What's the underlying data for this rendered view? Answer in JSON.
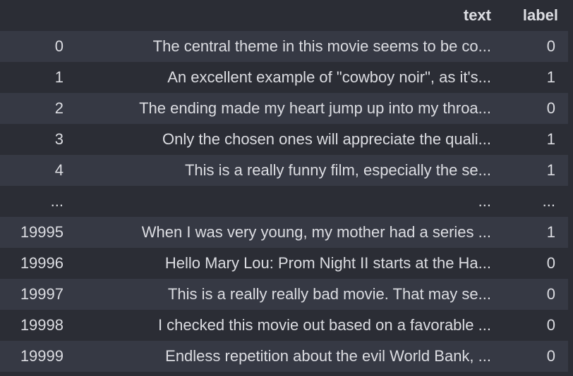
{
  "columns": {
    "index": "",
    "text": "text",
    "label": "label"
  },
  "rows": [
    {
      "index": "0",
      "text": "The central theme in this movie seems to be co...",
      "label": "0"
    },
    {
      "index": "1",
      "text": "An excellent example of \"cowboy noir\", as it's...",
      "label": "1"
    },
    {
      "index": "2",
      "text": "The ending made my heart jump up into my throa...",
      "label": "0"
    },
    {
      "index": "3",
      "text": "Only the chosen ones will appreciate the quali...",
      "label": "1"
    },
    {
      "index": "4",
      "text": "This is a really funny film, especially the se...",
      "label": "1"
    },
    {
      "index": "...",
      "text": "...",
      "label": "..."
    },
    {
      "index": "19995",
      "text": "When I was very young, my mother had a series ...",
      "label": "1"
    },
    {
      "index": "19996",
      "text": "Hello Mary Lou: Prom Night II starts at the Ha...",
      "label": "0"
    },
    {
      "index": "19997",
      "text": "This is a really really bad movie. That may se...",
      "label": "0"
    },
    {
      "index": "19998",
      "text": "I checked this movie out based on a favorable ...",
      "label": "0"
    },
    {
      "index": "19999",
      "text": "Endless repetition about the evil World Bank, ...",
      "label": "0"
    }
  ]
}
